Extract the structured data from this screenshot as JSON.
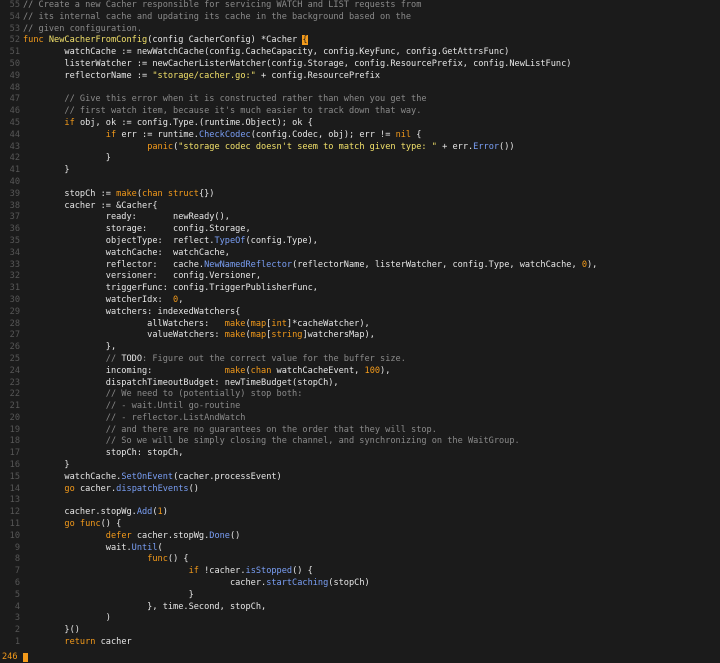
{
  "editor": {
    "status_line_number": "246",
    "lines": [
      {
        "n": "55",
        "segs": [
          {
            "t": "// Create a new Cacher responsible for servicing WATCH and LIST requests from",
            "c": "comment"
          }
        ]
      },
      {
        "n": "54",
        "segs": [
          {
            "t": "// its internal cache and updating its cache in the background based on the",
            "c": "comment"
          }
        ]
      },
      {
        "n": "53",
        "segs": [
          {
            "t": "// given configuration.",
            "c": "comment"
          }
        ]
      },
      {
        "n": "52",
        "segs": [
          {
            "t": "func ",
            "c": "kw"
          },
          {
            "t": "NewCacherFromConfig",
            "c": "str"
          },
          {
            "t": "(config CacherConfig) *Cacher ",
            "c": "plain"
          },
          {
            "t": "{",
            "c": "cursor"
          }
        ]
      },
      {
        "n": "51",
        "segs": [
          {
            "t": "        watchCache := newWatchCache(config.CacheCapacity, config.KeyFunc, config.GetAttrsFunc)",
            "c": "plain"
          }
        ]
      },
      {
        "n": "50",
        "segs": [
          {
            "t": "        listerWatcher := newCacherListerWatcher(config.Storage, config.ResourcePrefix, config.NewListFunc)",
            "c": "plain"
          }
        ]
      },
      {
        "n": "49",
        "segs": [
          {
            "t": "        reflectorName := ",
            "c": "plain"
          },
          {
            "t": "\"storage/cacher.go:\"",
            "c": "str"
          },
          {
            "t": " + config.ResourcePrefix",
            "c": "plain"
          }
        ]
      },
      {
        "n": "48",
        "segs": []
      },
      {
        "n": "47",
        "segs": [
          {
            "t": "        // Give this error when it is constructed rather than when you get the",
            "c": "comment"
          }
        ]
      },
      {
        "n": "46",
        "segs": [
          {
            "t": "        // first watch item, because it's much easier to track down that way.",
            "c": "comment"
          }
        ]
      },
      {
        "n": "45",
        "segs": [
          {
            "t": "        ",
            "c": "plain"
          },
          {
            "t": "if",
            "c": "kw"
          },
          {
            "t": " obj, ok := config.Type.(runtime.Object); ok {",
            "c": "plain"
          }
        ]
      },
      {
        "n": "44",
        "segs": [
          {
            "t": "                ",
            "c": "plain"
          },
          {
            "t": "if",
            "c": "kw"
          },
          {
            "t": " err := runtime.",
            "c": "plain"
          },
          {
            "t": "CheckCodec",
            "c": "call"
          },
          {
            "t": "(config.Codec, obj); err != ",
            "c": "plain"
          },
          {
            "t": "nil",
            "c": "kw"
          },
          {
            "t": " {",
            "c": "plain"
          }
        ]
      },
      {
        "n": "43",
        "segs": [
          {
            "t": "                        ",
            "c": "plain"
          },
          {
            "t": "panic",
            "c": "kw"
          },
          {
            "t": "(",
            "c": "plain"
          },
          {
            "t": "\"storage codec doesn't seem to match given type: \"",
            "c": "str"
          },
          {
            "t": " + err.",
            "c": "plain"
          },
          {
            "t": "Error",
            "c": "call"
          },
          {
            "t": "())",
            "c": "plain"
          }
        ]
      },
      {
        "n": "42",
        "segs": [
          {
            "t": "                }",
            "c": "plain"
          }
        ]
      },
      {
        "n": "41",
        "segs": [
          {
            "t": "        }",
            "c": "plain"
          }
        ]
      },
      {
        "n": "40",
        "segs": []
      },
      {
        "n": "39",
        "segs": [
          {
            "t": "        stopCh := ",
            "c": "plain"
          },
          {
            "t": "make",
            "c": "kw"
          },
          {
            "t": "(",
            "c": "plain"
          },
          {
            "t": "chan struct",
            "c": "kw"
          },
          {
            "t": "{})",
            "c": "plain"
          }
        ]
      },
      {
        "n": "38",
        "segs": [
          {
            "t": "        cacher := &Cacher{",
            "c": "plain"
          }
        ]
      },
      {
        "n": "37",
        "segs": [
          {
            "t": "                ready:       newReady(),",
            "c": "plain"
          }
        ]
      },
      {
        "n": "36",
        "segs": [
          {
            "t": "                storage:     config.Storage,",
            "c": "plain"
          }
        ]
      },
      {
        "n": "35",
        "segs": [
          {
            "t": "                objectType:  reflect.",
            "c": "plain"
          },
          {
            "t": "TypeOf",
            "c": "call"
          },
          {
            "t": "(config.Type),",
            "c": "plain"
          }
        ]
      },
      {
        "n": "34",
        "segs": [
          {
            "t": "                watchCache:  watchCache,",
            "c": "plain"
          }
        ]
      },
      {
        "n": "33",
        "segs": [
          {
            "t": "                reflector:   cache.",
            "c": "plain"
          },
          {
            "t": "NewNamedReflector",
            "c": "call"
          },
          {
            "t": "(reflectorName, listerWatcher, config.Type, watchCache, ",
            "c": "plain"
          },
          {
            "t": "0",
            "c": "num"
          },
          {
            "t": "),",
            "c": "plain"
          }
        ]
      },
      {
        "n": "32",
        "segs": [
          {
            "t": "                versioner:   config.Versioner,",
            "c": "plain"
          }
        ]
      },
      {
        "n": "31",
        "segs": [
          {
            "t": "                triggerFunc: config.TriggerPublisherFunc,",
            "c": "plain"
          }
        ]
      },
      {
        "n": "30",
        "segs": [
          {
            "t": "                watcherIdx:  ",
            "c": "plain"
          },
          {
            "t": "0",
            "c": "num"
          },
          {
            "t": ",",
            "c": "plain"
          }
        ]
      },
      {
        "n": "29",
        "segs": [
          {
            "t": "                watchers: indexedWatchers{",
            "c": "plain"
          }
        ]
      },
      {
        "n": "28",
        "segs": [
          {
            "t": "                        allWatchers:   ",
            "c": "plain"
          },
          {
            "t": "make",
            "c": "kw"
          },
          {
            "t": "(",
            "c": "plain"
          },
          {
            "t": "map",
            "c": "kw"
          },
          {
            "t": "[",
            "c": "plain"
          },
          {
            "t": "int",
            "c": "kw"
          },
          {
            "t": "]*cacheWatcher),",
            "c": "plain"
          }
        ]
      },
      {
        "n": "27",
        "segs": [
          {
            "t": "                        valueWatchers: ",
            "c": "plain"
          },
          {
            "t": "make",
            "c": "kw"
          },
          {
            "t": "(",
            "c": "plain"
          },
          {
            "t": "map",
            "c": "kw"
          },
          {
            "t": "[",
            "c": "plain"
          },
          {
            "t": "string",
            "c": "kw"
          },
          {
            "t": "]watchersMap),",
            "c": "plain"
          }
        ]
      },
      {
        "n": "26",
        "segs": [
          {
            "t": "                },",
            "c": "plain"
          }
        ]
      },
      {
        "n": "25",
        "segs": [
          {
            "t": "                // ",
            "c": "comment"
          },
          {
            "t": "TODO",
            "c": "plain"
          },
          {
            "t": ": Figure out the correct value for the buffer size.",
            "c": "comment"
          }
        ]
      },
      {
        "n": "24",
        "segs": [
          {
            "t": "                incoming:              ",
            "c": "plain"
          },
          {
            "t": "make",
            "c": "kw"
          },
          {
            "t": "(",
            "c": "plain"
          },
          {
            "t": "chan",
            "c": "kw"
          },
          {
            "t": " watchCacheEvent, ",
            "c": "plain"
          },
          {
            "t": "100",
            "c": "num"
          },
          {
            "t": "),",
            "c": "plain"
          }
        ]
      },
      {
        "n": "23",
        "segs": [
          {
            "t": "                dispatchTimeoutBudget: newTimeBudget(stopCh),",
            "c": "plain"
          }
        ]
      },
      {
        "n": "22",
        "segs": [
          {
            "t": "                // We need to (potentially) stop both:",
            "c": "comment"
          }
        ]
      },
      {
        "n": "21",
        "segs": [
          {
            "t": "                // - wait.Until go-routine",
            "c": "comment"
          }
        ]
      },
      {
        "n": "20",
        "segs": [
          {
            "t": "                // - reflector.ListAndWatch",
            "c": "comment"
          }
        ]
      },
      {
        "n": "19",
        "segs": [
          {
            "t": "                // and there are no guarantees on the order that they will stop.",
            "c": "comment"
          }
        ]
      },
      {
        "n": "18",
        "segs": [
          {
            "t": "                // So we will be simply closing the channel, and synchronizing on the WaitGroup.",
            "c": "comment"
          }
        ]
      },
      {
        "n": "17",
        "segs": [
          {
            "t": "                stopCh: stopCh,",
            "c": "plain"
          }
        ]
      },
      {
        "n": "16",
        "segs": [
          {
            "t": "        }",
            "c": "plain"
          }
        ]
      },
      {
        "n": "15",
        "segs": [
          {
            "t": "        watchCache.",
            "c": "plain"
          },
          {
            "t": "SetOnEvent",
            "c": "call"
          },
          {
            "t": "(cacher.processEvent)",
            "c": "plain"
          }
        ]
      },
      {
        "n": "14",
        "segs": [
          {
            "t": "        ",
            "c": "plain"
          },
          {
            "t": "go",
            "c": "kw"
          },
          {
            "t": " cacher.",
            "c": "plain"
          },
          {
            "t": "dispatchEvents",
            "c": "call"
          },
          {
            "t": "()",
            "c": "plain"
          }
        ]
      },
      {
        "n": "13",
        "segs": []
      },
      {
        "n": "12",
        "segs": [
          {
            "t": "        cacher.stopWg.",
            "c": "plain"
          },
          {
            "t": "Add",
            "c": "call"
          },
          {
            "t": "(",
            "c": "plain"
          },
          {
            "t": "1",
            "c": "num"
          },
          {
            "t": ")",
            "c": "plain"
          }
        ]
      },
      {
        "n": "11",
        "segs": [
          {
            "t": "        ",
            "c": "plain"
          },
          {
            "t": "go func",
            "c": "kw"
          },
          {
            "t": "() {",
            "c": "plain"
          }
        ]
      },
      {
        "n": "10",
        "segs": [
          {
            "t": "                ",
            "c": "plain"
          },
          {
            "t": "defer",
            "c": "kw"
          },
          {
            "t": " cacher.stopWg.",
            "c": "plain"
          },
          {
            "t": "Done",
            "c": "call"
          },
          {
            "t": "()",
            "c": "plain"
          }
        ]
      },
      {
        "n": "9",
        "segs": [
          {
            "t": "                wait.",
            "c": "plain"
          },
          {
            "t": "Until",
            "c": "call"
          },
          {
            "t": "(",
            "c": "plain"
          }
        ]
      },
      {
        "n": "8",
        "segs": [
          {
            "t": "                        ",
            "c": "plain"
          },
          {
            "t": "func",
            "c": "kw"
          },
          {
            "t": "() {",
            "c": "plain"
          }
        ]
      },
      {
        "n": "7",
        "segs": [
          {
            "t": "                                ",
            "c": "plain"
          },
          {
            "t": "if",
            "c": "kw"
          },
          {
            "t": " !cacher.",
            "c": "plain"
          },
          {
            "t": "isStopped",
            "c": "call"
          },
          {
            "t": "() {",
            "c": "plain"
          }
        ]
      },
      {
        "n": "6",
        "segs": [
          {
            "t": "                                        cacher.",
            "c": "plain"
          },
          {
            "t": "startCaching",
            "c": "call"
          },
          {
            "t": "(stopCh)",
            "c": "plain"
          }
        ]
      },
      {
        "n": "5",
        "segs": [
          {
            "t": "                                }",
            "c": "plain"
          }
        ]
      },
      {
        "n": "4",
        "segs": [
          {
            "t": "                        }, time.Second, stopCh,",
            "c": "plain"
          }
        ]
      },
      {
        "n": "3",
        "segs": [
          {
            "t": "                )",
            "c": "plain"
          }
        ]
      },
      {
        "n": "2",
        "segs": [
          {
            "t": "        }()",
            "c": "plain"
          }
        ]
      },
      {
        "n": "1",
        "segs": [
          {
            "t": "        ",
            "c": "plain"
          },
          {
            "t": "return",
            "c": "kw"
          },
          {
            "t": " cacher",
            "c": "plain"
          }
        ]
      }
    ]
  }
}
